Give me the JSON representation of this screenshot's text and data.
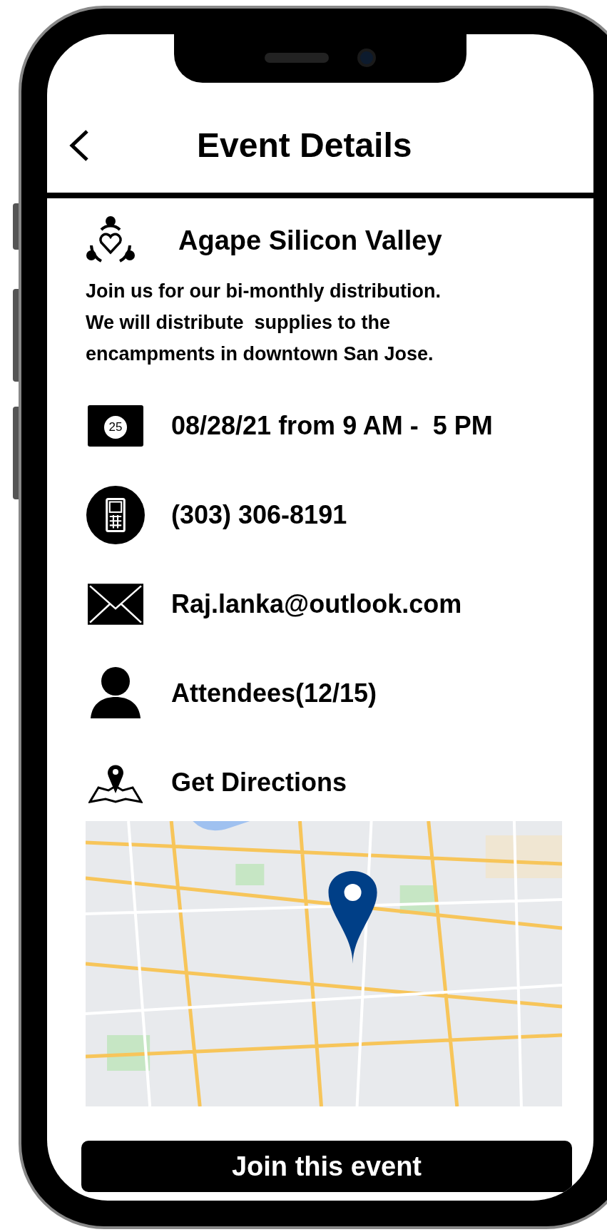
{
  "header": {
    "title": "Event Details"
  },
  "organization": {
    "name": "Agape Silicon Valley"
  },
  "description": "Join us for our bi-monthly distribution.\nWe will distribute  supplies to the\nencampments in downtown San Jose.",
  "details": [
    {
      "kind": "date",
      "text": "08/28/21 from 9 AM -  5 PM",
      "calendar_day": "25"
    },
    {
      "kind": "phone",
      "text": "(303) 306-8191"
    },
    {
      "kind": "email",
      "text": "Raj.lanka@outlook.com"
    },
    {
      "kind": "attendees",
      "text": "Attendees(12/15)"
    },
    {
      "kind": "directions",
      "text": "Get Directions"
    }
  ],
  "join_button": {
    "label": "Join this event"
  }
}
